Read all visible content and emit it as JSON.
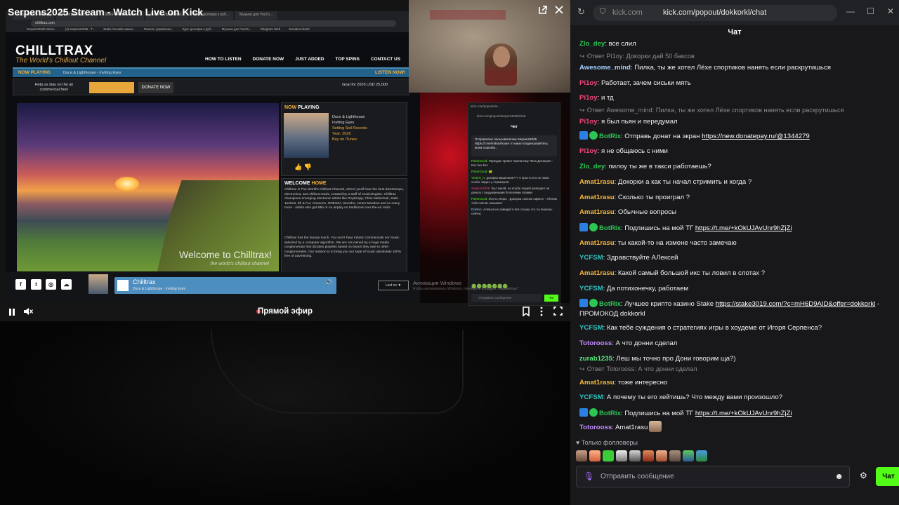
{
  "player": {
    "title": "Serpens2025 Stream - Watch Live on Kick",
    "live_label": "Прямой эфир",
    "popout_icon": "popout-icon",
    "close_icon": "close-icon"
  },
  "stream_browser": {
    "tabs": [
      "Serpens2025 Strea...",
      "(4) serpens2025 - T...",
      "Stake Онлайн-казин...",
      "Панель управлени...",
      "Курс доллара к руб...",
      "Музыка для YouTu...",
      "Telegram Web",
      "DonationAlerts"
    ],
    "url": "chilltrax.com",
    "update_button": "Доступно обновление Chrome"
  },
  "chilltrax": {
    "logo": "CHILLTRAX",
    "tagline": "The World's Chillout Channel",
    "nav": [
      "HOW TO LISTEN",
      "DONATE NOW",
      "JUST ADDED",
      "TOP SPINS",
      "CONTACT US"
    ],
    "now_playing_label": "NOW PLAYING",
    "now_playing_track": "Duce & Lighthouse - Inviting Eyes",
    "listen_now": "LISTEN NOW!",
    "donate_text": "Help us stay on the air commercial free!",
    "donate_button": "DONATE NOW",
    "goal_text": "Goal for 2026 USD 25,000",
    "panel_title_a": "NOW",
    "panel_title_b": "PLAYING",
    "artist": "Duce & Lighthouse",
    "song": "Inviting Eyes",
    "label_line": "Setting Soil Records",
    "year": "Year: 2026",
    "buy": "Buy on iTunes",
    "welcome_a": "WELCOME",
    "welcome_b": "HOME",
    "welcome_p1": "Chilltrax is The World's Chillout Channel, where you'll hear the best downtempo, electronica, and chillout music, curated by a staff of musicologists. Chilltrax champions emerging electronic artists like Royksopp, Chris Malinchak, Satin Jackets, Eli & Fur, Cannons, ODESZA, Bonobo, Jones Meadow and so many more - artists who get little or no airplay on traditional over-the-air radio.",
    "welcome_p2": "Chilltrax has the human touch. You won't hear robotic commercials nor music selected by a computer algorithm. We are not owned by a huge media conglomerate that dictates playlists based on favors they owe to other conglomerates. Our mission is to bring you our style of music absolutely 100% free of advertising.",
    "hero_title": "Welcome to Chilltrax!",
    "hero_sub": "the world's chillout channel",
    "player_title": "Chilltrax",
    "player_sub": "Duce & Lighthouse - Inviting Eyes",
    "player_vol": "100%",
    "last_button": "Last so ▼"
  },
  "mini_chat": {
    "tab": "kick.com/popout/se...",
    "url": "kick.com/popout/serpens2025/chat",
    "title": "Чат",
    "pinned": "Отправлено пользователем Serpens2025 https://t.me/mitrovhouse тг канал подписывайтесь всем спасибо...",
    "msgs": [
      {
        "u": "PokerGood:",
        "t": "Передаю привет Хрипатому Лёха Дохкерия - Kex kex kex"
      },
      {
        "u": "PokerGood:",
        "t": "🐸"
      },
      {
        "u": "YOSHI_A:",
        "t": "докорка машенник??? я просто его не знаю особо. видео у стримеров"
      },
      {
        "u": "Serpens2025:",
        "t": "был какой, на ютубе людей разводил на деньги с выдуманными болезнями своими"
      },
      {
        "u": "PokerGood:",
        "t": "Жесть Игорь - Докорка совсем офигел - Убогим тебя сейчас называет"
      },
      {
        "u": "Dolnnic:",
        "t": "Алёшка не завидуй я всё слышу что ты пишешь сейчас"
      }
    ],
    "input": "Отправить сообщение",
    "send": "Чат"
  },
  "windows_activation": {
    "line1": "Активация Windows",
    "line2": "Чтобы активировать Windows, перейдите в раздел \"Параметры\""
  },
  "chat": {
    "url_host": "kick.com",
    "url_path": "kick.com/popout/dokkorkl/chat",
    "title": "Чат",
    "msgs": [
      {
        "kind": "msg",
        "user": "Zlo_dey",
        "color": "#2dc653",
        "text": ": все слил"
      },
      {
        "kind": "reply",
        "text": "Ответ Pi1oy: Докорки дай 50 баксов"
      },
      {
        "kind": "msg",
        "user": "Awesome_mind",
        "color": "#a3d0ff",
        "text": ": Пилка, ты же хотел Лёхе спортиков нанять если раскрутишься"
      },
      {
        "kind": "msg",
        "user": "Pi1oy",
        "color": "#f1477a",
        "text": ": Работает, зачем сиськи мять"
      },
      {
        "kind": "msg",
        "user": "Pi1oy",
        "color": "#f1477a",
        "text": ": и тд"
      },
      {
        "kind": "reply",
        "text": "Ответ Awesome_mind: Пилка, ты же хотел Лёхе спортиков нанять если раскрутишься"
      },
      {
        "kind": "msg",
        "user": "Pi1oy",
        "color": "#f1477a",
        "text": ": я был пьян и передумал"
      },
      {
        "kind": "bot",
        "user": "BotRix",
        "color": "#2dc653",
        "text": ": Отправь донат на экран ",
        "link": "https://new.donatepay.ru/@1344279"
      },
      {
        "kind": "msg",
        "user": "Pi1oy",
        "color": "#f1477a",
        "text": ": я не общаюсь с ними"
      },
      {
        "kind": "msg",
        "user": "Zlo_dey",
        "color": "#2dc653",
        "text": ": пилоу ты же в такси работаешь?"
      },
      {
        "kind": "msg",
        "user": "Amat1rasu",
        "color": "#f5b83d",
        "text": ": Докорки а как ты начал стримить и когда ?"
      },
      {
        "kind": "msg",
        "user": "Amat1rasu",
        "color": "#f5b83d",
        "text": ": Сколько ты проиграл ?"
      },
      {
        "kind": "msg",
        "user": "Amat1rasu",
        "color": "#f5b83d",
        "text": ": Обычные вопросы"
      },
      {
        "kind": "bot",
        "user": "BotRix",
        "color": "#2dc653",
        "text": ": Подпишись на мой ТГ ",
        "link": "https://t.me/+kOkUJAvUnr9hZjZi"
      },
      {
        "kind": "msg",
        "user": "Amat1rasu",
        "color": "#f5b83d",
        "text": ": ты какой-то на измене часто замечаю"
      },
      {
        "kind": "msg",
        "user": "YCFSM",
        "color": "#2dc6c1",
        "text": ": Здравствуйте АЛексей"
      },
      {
        "kind": "msg",
        "user": "Amat1rasu",
        "color": "#f5b83d",
        "text": ": Какой самый большой икс ты ловил в слотах ?"
      },
      {
        "kind": "msg",
        "user": "YCFSM",
        "color": "#2dc6c1",
        "text": ": Да потихонечку, работаем"
      },
      {
        "kind": "bot2",
        "user": "BotRix",
        "color": "#2dc653",
        "text": ": Лучшее крипто казино Stake ",
        "link": "https://stake3019.com/?c=mH6D9AID&offer=dokkorkl",
        "tail": " - ПРОМОКОД dokkorkl"
      },
      {
        "kind": "msg",
        "user": "YCFSM",
        "color": "#2dc6c1",
        "text": ": Как тебе суждения о стратегиях игры в хоудеме от Игоря Серпенса?"
      },
      {
        "kind": "msg",
        "user": "Totorooss",
        "color": "#c48cff",
        "text": ": А что донни сделал"
      },
      {
        "kind": "msg",
        "user": "zurab1235",
        "color": "#5ee87a",
        "text": ": Леш мы точно про Дони говорим ща?)"
      },
      {
        "kind": "reply",
        "text": "Ответ Totorooss: А что донни сделал"
      },
      {
        "kind": "msg",
        "user": "Amat1rasu",
        "color": "#f5b83d",
        "text": ": тоже интересно"
      },
      {
        "kind": "msg",
        "user": "YCFSM",
        "color": "#2dc6c1",
        "text": ": А почему ты его хейтишь? Что между вами произошло?"
      },
      {
        "kind": "bot",
        "user": "BotRix",
        "color": "#2dc653",
        "text": ": Подпишись на мой ТГ ",
        "link": "https://t.me/+kOkUJAvUnr9hZjZi"
      },
      {
        "kind": "emote",
        "user": "Totorooss",
        "color": "#c48cff",
        "text": ": Amat1rasu"
      }
    ],
    "followers_only": "Только фолловеры",
    "input_placeholder": "Отправить сообщение",
    "send_label": "Чат"
  }
}
